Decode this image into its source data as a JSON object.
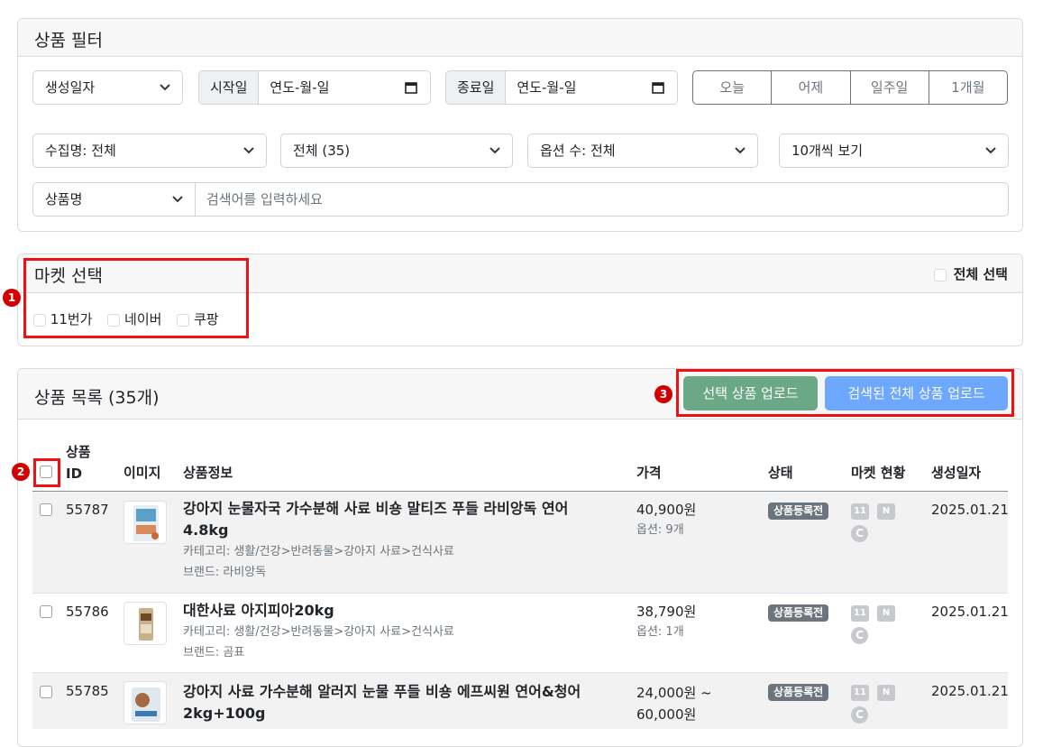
{
  "filter": {
    "title": "상품 필터",
    "date_type": "생성일자",
    "start_label": "시작일",
    "start_value": "연도-월-일",
    "end_label": "종료일",
    "end_value": "연도-월-일",
    "quick_buttons": [
      "오늘",
      "어제",
      "일주일",
      "1개월"
    ],
    "collection": "수집명: 전체",
    "status_filter": "전체 (35)",
    "option_count": "옵션 수: 전체",
    "page_size": "10개씩 보기",
    "search_field": "상품명",
    "search_placeholder": "검색어를 입력하세요"
  },
  "market": {
    "title": "마켓 선택",
    "select_all": "전체 선택",
    "options": [
      "11번가",
      "네이버",
      "쿠팡"
    ]
  },
  "annotations": [
    "1",
    "2",
    "3"
  ],
  "products": {
    "title": "상품 목록 (35개)",
    "upload_selected": "선택 상품 업로드",
    "upload_all": "검색된 전체 상품 업로드",
    "columns": {
      "id_line1": "상품",
      "id_line2": "ID",
      "image": "이미지",
      "info": "상품정보",
      "price": "가격",
      "status": "상태",
      "market": "마켓 현황",
      "created": "생성일자"
    },
    "rows": [
      {
        "id": "55787",
        "name_line1": "강아지 눈물자국 가수분해 사료 비숑 말티즈 푸들 라비앙독 연어",
        "name_line2": "4.8kg",
        "category": "카테고리: 생활/건강>반려동물>강아지 사료>건식사료",
        "brand": "브랜드: 라비앙독",
        "price_line1": "40,900원",
        "price_line2": "",
        "options": "옵션: 9개",
        "status": "상품등록전",
        "created": "2025.01.21"
      },
      {
        "id": "55786",
        "name_line1": "대한사료 아지피아20kg",
        "name_line2": "",
        "category": "카테고리: 생활/건강>반려동물>강아지 사료>건식사료",
        "brand": "브랜드: 곰표",
        "price_line1": "38,790원",
        "price_line2": "",
        "options": "옵션: 1개",
        "status": "상품등록전",
        "created": "2025.01.21"
      },
      {
        "id": "55785",
        "name_line1": "강아지 사료 가수분해 알러지 눈물 푸들 비숑 에프씨원 연어&청어",
        "name_line2": "2kg+100g",
        "category": "",
        "brand": "",
        "price_line1": "24,000원 ~",
        "price_line2": "60,000원",
        "options": "",
        "status": "상품등록전",
        "created": "2025.01.21"
      }
    ],
    "market_icons": {
      "elevenst": "11",
      "naver": "N",
      "coupang": "C"
    }
  }
}
